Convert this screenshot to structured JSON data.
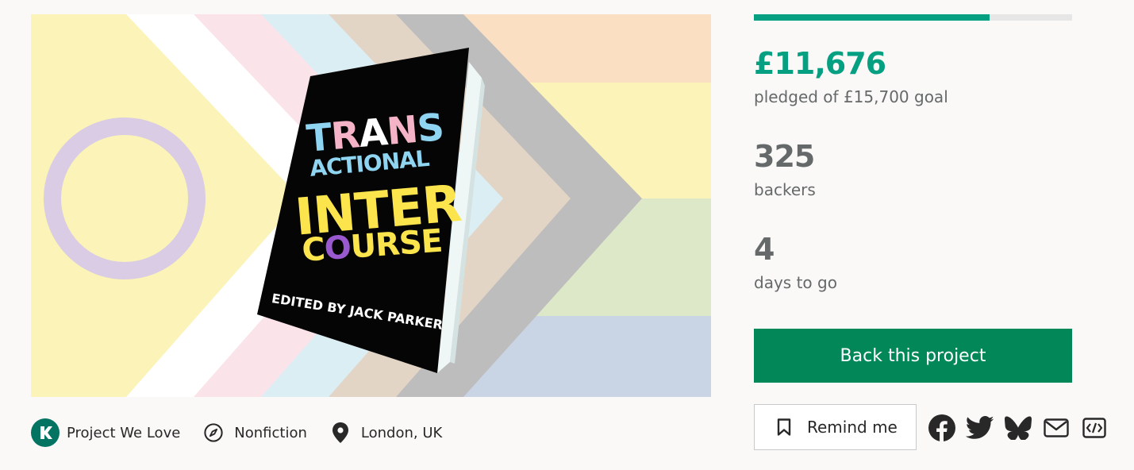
{
  "hero": {
    "book": {
      "line1": "TRANS",
      "line2": "ACTIONAL",
      "line3": "INTER",
      "line4a": "C",
      "line4b": "O",
      "line4c": "URSE",
      "editor": "EDITED BY JACK PARKER"
    }
  },
  "meta": {
    "badge_label": "Project We Love",
    "category_label": "Nonfiction",
    "location_label": "London, UK"
  },
  "stats": {
    "progress_fraction": 0.74,
    "pledged_amount": "£11,676",
    "pledged_label": "pledged of £15,700 goal",
    "backers_count": "325",
    "backers_label": "backers",
    "days_count": "4",
    "days_label": "days to go"
  },
  "actions": {
    "back_label": "Back this project",
    "remind_label": "Remind me"
  },
  "share": [
    "facebook-icon",
    "twitter-icon",
    "bluesky-icon",
    "email-icon",
    "embed-icon"
  ],
  "colors": {
    "accent": "#05a081",
    "button": "#028858"
  }
}
